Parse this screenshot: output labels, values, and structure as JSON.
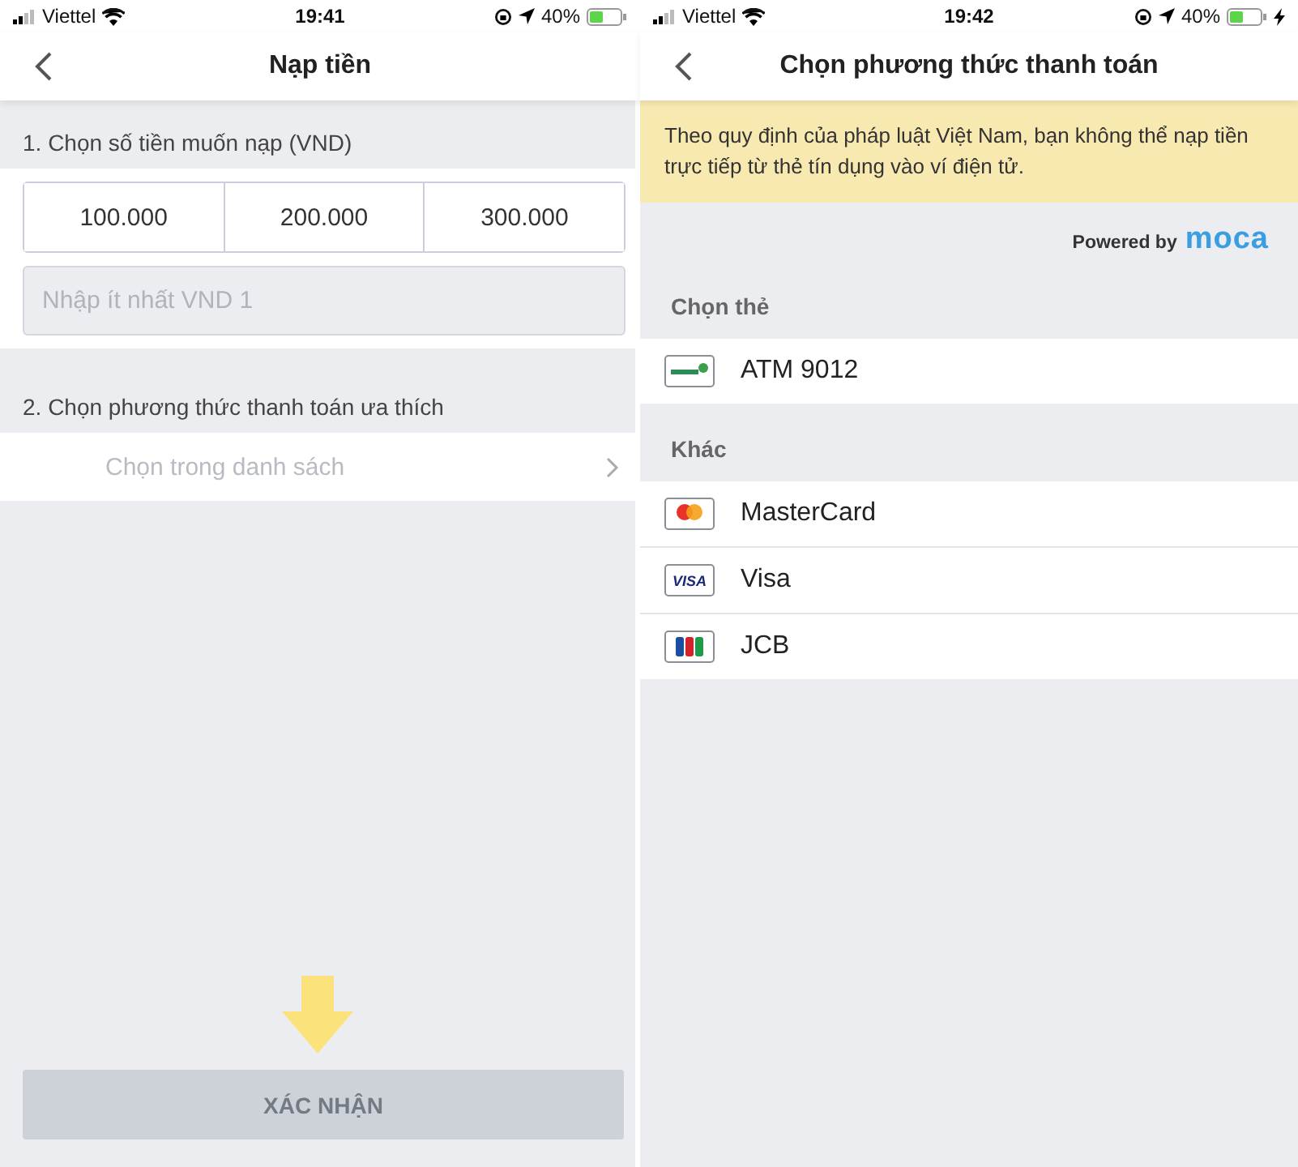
{
  "screens": [
    {
      "status_bar": {
        "carrier": "Viettel",
        "time": "19:41",
        "battery": "40%"
      },
      "nav": {
        "title": "Nạp tiền"
      },
      "amount_section": {
        "label": "1. Chọn số tiền muốn nạp (VND)",
        "options": [
          "100.000",
          "200.000",
          "300.000"
        ],
        "placeholder": "Nhập ít nhất VND 1"
      },
      "method_section": {
        "label": "2. Chọn phương thức thanh toán ưa thích",
        "placeholder": "Chọn trong danh sách"
      },
      "confirm_button": {
        "label": "XÁC NHẬN",
        "disabled": true
      }
    },
    {
      "status_bar": {
        "carrier": "Viettel",
        "time": "19:42",
        "battery": "40%",
        "charging": true
      },
      "nav": {
        "title": "Chọn phương thức thanh toán"
      },
      "notice": "Theo quy định của pháp luật Việt Nam, bạn không thể nạp tiền trực tiếp từ thẻ tín dụng vào ví điện tử.",
      "powered_by": {
        "text": "Powered by",
        "brand": "moca"
      },
      "groups": [
        {
          "title": "Chọn thẻ",
          "items": [
            {
              "label": "ATM 9012",
              "kind": "bank"
            }
          ]
        },
        {
          "title": "Khác",
          "items": [
            {
              "label": "MasterCard",
              "kind": "mastercard"
            },
            {
              "label": "Visa",
              "kind": "visa",
              "logo_text": "VISA"
            },
            {
              "label": "JCB",
              "kind": "jcb"
            }
          ]
        }
      ]
    }
  ]
}
